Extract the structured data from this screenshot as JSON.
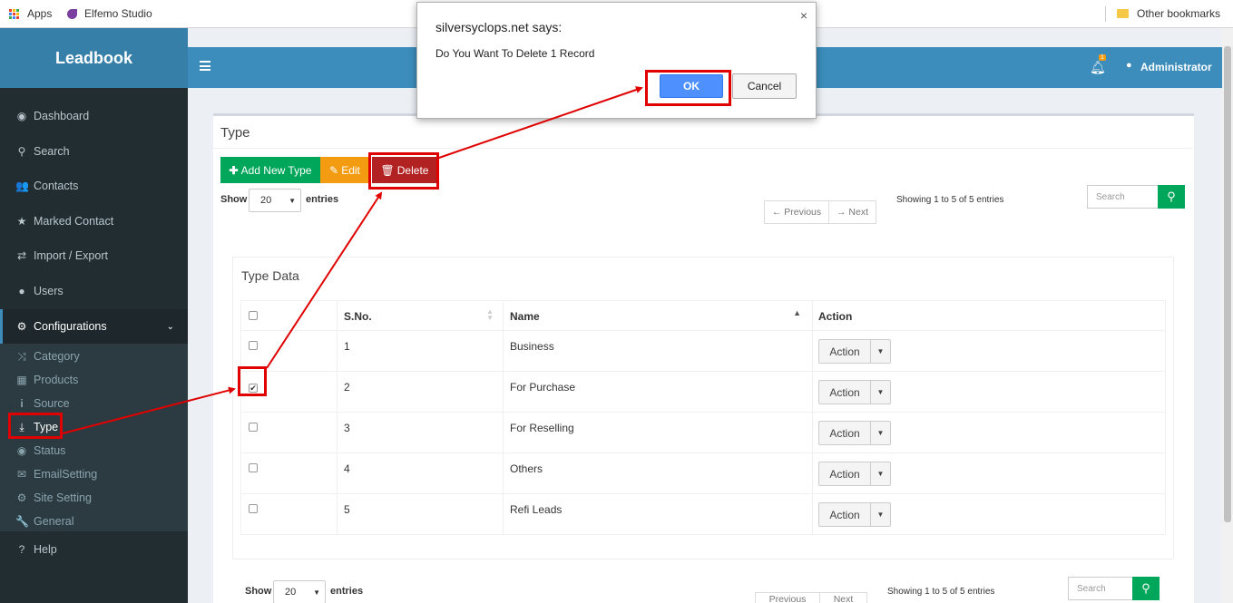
{
  "bookmarks": {
    "apps": "Apps",
    "studio": "Elfemo Studio",
    "other": "Other bookmarks"
  },
  "brand": "Leadbook",
  "header": {
    "notif_count": "1",
    "user": "Administrator"
  },
  "menu": [
    {
      "label": "Dashboard",
      "icon": "dashboard-icon"
    },
    {
      "label": "Search",
      "icon": "search-icon"
    },
    {
      "label": "Contacts",
      "icon": "users-icon"
    },
    {
      "label": "Marked Contact",
      "icon": "star-icon"
    },
    {
      "label": "Import / Export",
      "icon": "exchange-icon"
    },
    {
      "label": "Users",
      "icon": "user-icon"
    },
    {
      "label": "Configurations",
      "icon": "cogs-icon"
    }
  ],
  "submenu": [
    {
      "label": "Category",
      "icon": "random-icon"
    },
    {
      "label": "Products",
      "icon": "products-icon"
    },
    {
      "label": "Source",
      "icon": "info-icon"
    },
    {
      "label": "Type",
      "icon": "download-icon"
    },
    {
      "label": "Status",
      "icon": "eye-icon"
    },
    {
      "label": "EmailSetting",
      "icon": "envelope-icon"
    },
    {
      "label": "Site Setting",
      "icon": "gear-icon"
    },
    {
      "label": "General",
      "icon": "wrench-icon"
    }
  ],
  "help": "Help",
  "page": {
    "title": "Type",
    "add": "Add New Type",
    "edit": "Edit",
    "delete": "Delete",
    "show": "Show",
    "entries": "entries",
    "page_size": "20",
    "prev": "← Previous",
    "next": "→ Next",
    "info": "Showing 1 to 5 of 5 entries",
    "search_placeholder": "Search",
    "inner_title": "Type Data"
  },
  "table": {
    "headers": [
      "S.No.",
      "Name",
      "Action"
    ],
    "rows": [
      {
        "sno": "1",
        "name": "Business",
        "checked": false
      },
      {
        "sno": "2",
        "name": "For Purchase",
        "checked": true
      },
      {
        "sno": "3",
        "name": "For Reselling",
        "checked": false
      },
      {
        "sno": "4",
        "name": "Others",
        "checked": false
      },
      {
        "sno": "5",
        "name": "Refi Leads",
        "checked": false
      }
    ],
    "action_label": "Action"
  },
  "bottom": {
    "show": "Show",
    "entries": "entries",
    "page_size": "20",
    "info": "Showing 1 to 5 of 5 entries",
    "search_placeholder": "Search",
    "prev": "Previous",
    "next": "Next"
  },
  "dialog": {
    "title": "silversyclops.net says:",
    "message": "Do You Want To Delete 1 Record",
    "ok": "OK",
    "cancel": "Cancel"
  },
  "colors": {
    "sidebar": "#222d32",
    "header": "#3c8dbc",
    "add": "#00a65a",
    "edit": "#f39c12",
    "delete": "#b22222",
    "annotation": "#e00000"
  }
}
